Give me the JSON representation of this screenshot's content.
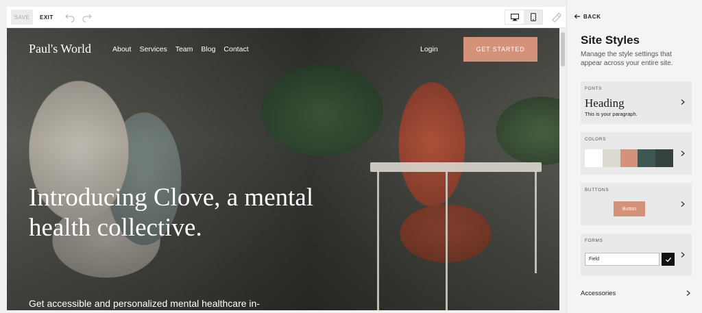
{
  "toolbar": {
    "save_label": "SAVE",
    "exit_label": "EXIT",
    "icons": [
      "undo-icon",
      "redo-icon",
      "desktop-icon",
      "mobile-icon",
      "brush-icon"
    ]
  },
  "site": {
    "brand": "Paul's World",
    "nav": [
      "About",
      "Services",
      "Team",
      "Blog",
      "Contact"
    ],
    "login": "Login",
    "cta": "GET STARTED",
    "headline": "Introducing Clove, a mental health collective.",
    "subhead": "Get accessible and personalized mental healthcare in-"
  },
  "panel": {
    "back_label": "BACK",
    "title": "Site Styles",
    "description": "Manage the style settings that appear across your entire site.",
    "fonts": {
      "label": "FONTS",
      "heading": "Heading",
      "paragraph": "This is your paragraph."
    },
    "colors": {
      "label": "COLORS",
      "swatches": [
        "#ffffff",
        "#dcd8d2",
        "#d4927a",
        "#3f5753",
        "#35433f"
      ]
    },
    "buttons": {
      "label": "BUTTONS",
      "sample": "Button"
    },
    "forms": {
      "label": "FORMS",
      "field": "Field"
    },
    "accessories": "Accessories"
  },
  "colors": {
    "accent": "#d4927a",
    "panel_bg": "#f4f4f4",
    "card_bg": "#e9e9e9"
  }
}
